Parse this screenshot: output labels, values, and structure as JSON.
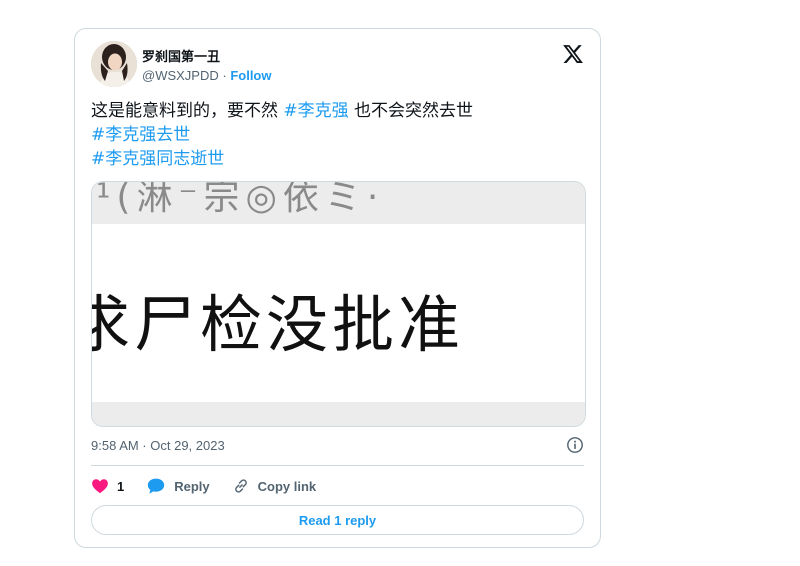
{
  "author": {
    "display_name": "罗刹国第一丑",
    "handle": "@WSXJPDD",
    "separator": " · ",
    "follow_label": "Follow"
  },
  "tweet": {
    "text_before": "这是能意料到的，要不然 ",
    "hashtag_inline": "#李克强",
    "text_after": " 也不会突然去世",
    "hashtag_line2": "#李克强去世",
    "hashtag_line3": "#李克强同志逝世"
  },
  "media": {
    "top_text": "¹(淋⁻宗◎依ミ·",
    "main_text": "求尸检没批准"
  },
  "timestamp": "9:58 AM · Oct 29, 2023",
  "actions": {
    "like_count": "1",
    "reply_label": "Reply",
    "copy_link_label": "Copy link"
  },
  "read_replies_label": "Read 1 reply",
  "icons": {
    "logo": "x-logo-icon",
    "info": "info-icon",
    "like": "heart-icon",
    "reply": "reply-bubble-icon",
    "copy": "link-icon"
  },
  "colors": {
    "link": "#1d9bf0",
    "like": "#f91880",
    "text": "#0f1419",
    "muted": "#536471",
    "border": "#cfd9de"
  }
}
